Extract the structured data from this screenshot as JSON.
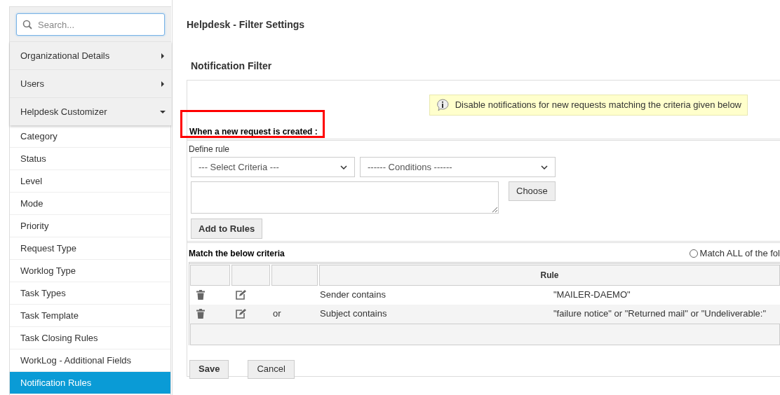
{
  "sidebar": {
    "search": {
      "placeholder": "Search..."
    },
    "groups": [
      {
        "label": "Organizational Details",
        "expanded": false
      },
      {
        "label": "Users",
        "expanded": false
      },
      {
        "label": "Helpdesk Customizer",
        "expanded": true
      }
    ],
    "items": [
      {
        "label": "Category",
        "selected": false
      },
      {
        "label": "Status",
        "selected": false
      },
      {
        "label": "Level",
        "selected": false
      },
      {
        "label": "Mode",
        "selected": false
      },
      {
        "label": "Priority",
        "selected": false
      },
      {
        "label": "Request Type",
        "selected": false
      },
      {
        "label": "Worklog Type",
        "selected": false
      },
      {
        "label": "Task Types",
        "selected": false
      },
      {
        "label": "Task Template",
        "selected": false
      },
      {
        "label": "Task Closing Rules",
        "selected": false
      },
      {
        "label": "WorkLog - Additional Fields",
        "selected": false
      },
      {
        "label": "Notification Rules",
        "selected": true
      }
    ]
  },
  "page_title": "Helpdesk - Filter Settings",
  "section_title": "Notification Filter",
  "info": "Disable notifications for new requests matching the criteria given below",
  "rule_heading": {
    "text": "When a new request is created :",
    "highlighted": true
  },
  "define_rule": "Define rule",
  "criteria_select": "--- Select Criteria ---",
  "conditions_select": "------ Conditions ------",
  "choose_button": "Choose",
  "add_button": "Add to Rules",
  "match_label": "Match the below criteria",
  "match_all": {
    "label": "Match ALL of the fol",
    "selected": false
  },
  "table": {
    "columns": [
      "",
      "",
      "",
      "Rule"
    ],
    "rows": [
      {
        "join": "",
        "field": "Sender contains",
        "value": "\"MAILER-DAEMO\""
      },
      {
        "join": "or",
        "field": "Subject contains",
        "value": "\"failure notice\" or \"Returned mail\" or \"Undeliverable:\""
      }
    ]
  },
  "buttons": [
    "Save",
    "Cancel"
  ]
}
